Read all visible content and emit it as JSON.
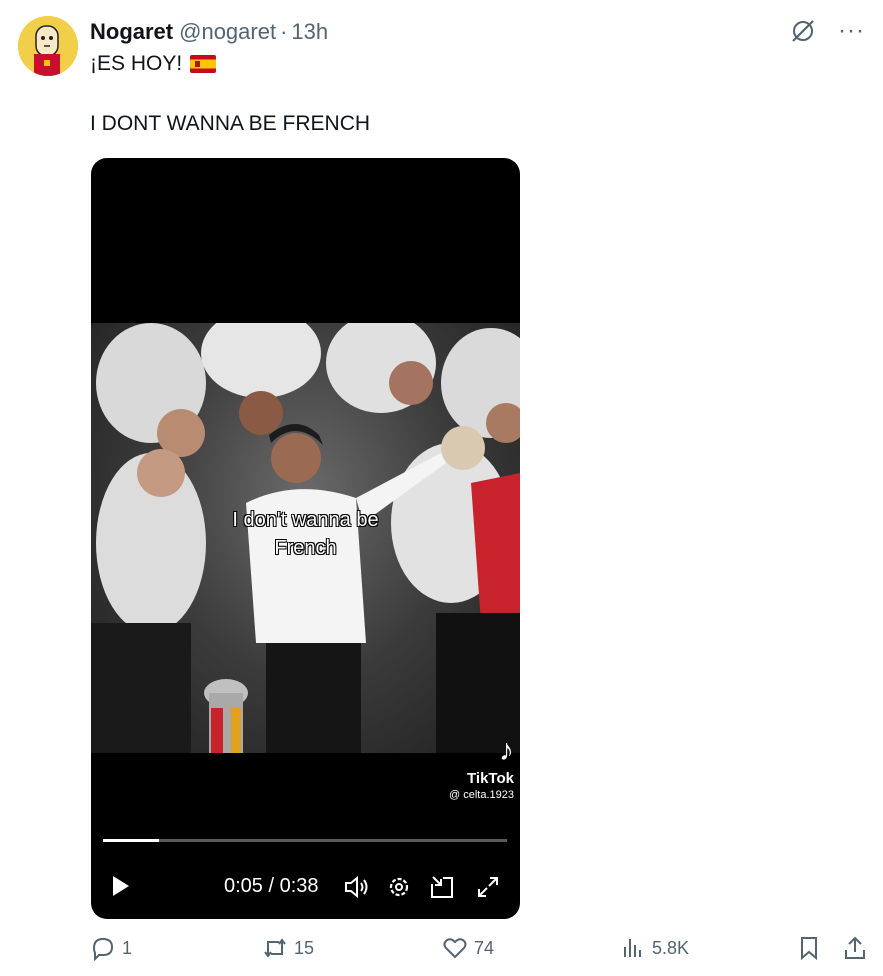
{
  "post": {
    "author_name": "Nogaret",
    "handle": "@nogaret",
    "separator": "·",
    "time": "13h",
    "line1": "¡ES HOY!",
    "line1_emoji": "spain-flag",
    "line2": "I DONT WANNA BE FRENCH"
  },
  "video": {
    "caption_line1": "I don't wanna be",
    "caption_line2": "French",
    "watermark_brand": "TikTok",
    "watermark_user": "@ celta.1923",
    "timecode": "0:05 / 0:38",
    "progress": 0.138
  },
  "icons": {
    "top": [
      "grok-icon",
      "more-icon"
    ],
    "controls": [
      "play-icon",
      "volume-icon",
      "settings-icon",
      "picture-in-picture-icon",
      "fullscreen-icon"
    ],
    "actions": [
      "reply-icon",
      "repost-icon",
      "like-icon",
      "views-icon",
      "bookmark-icon",
      "share-icon"
    ]
  },
  "more_label": "···",
  "actions": {
    "replies": "1",
    "reposts": "15",
    "likes": "74",
    "views": "5.8K"
  },
  "colors": {
    "avatar_bg": "#f2cf4a",
    "muted_text": "#536471",
    "video_bg": "#000000"
  }
}
